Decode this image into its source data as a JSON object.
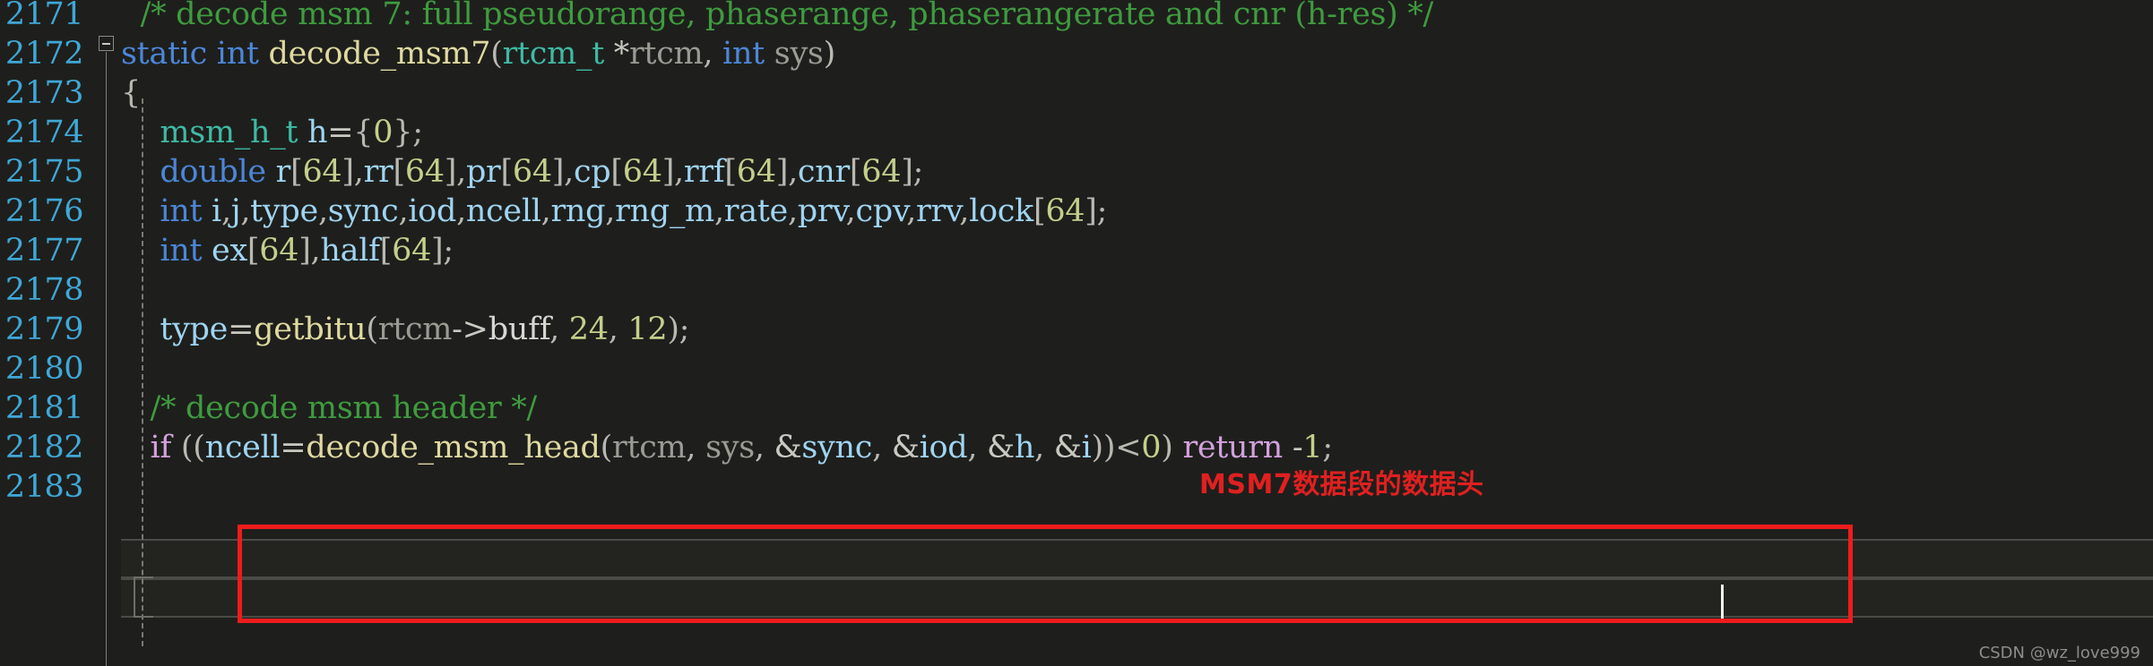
{
  "editor": {
    "background": "#1e1f1c",
    "line_number_color": "#3fa8d8",
    "font_size_px": 35,
    "line_height_px": 44,
    "first_visible_line": 2171,
    "last_visible_line": 2183
  },
  "line_numbers": [
    "2171",
    "2172",
    "2173",
    "2174",
    "2175",
    "2176",
    "2177",
    "2178",
    "2179",
    "2180",
    "2181",
    "2182",
    "2183"
  ],
  "lines": [
    {
      "number": "2171",
      "tokens": [
        {
          "text": "  ",
          "kind": "plain"
        },
        {
          "text": "/* decode msm 7: full pseudorange, phaserange, phaserangerate and cnr (h-res) */",
          "kind": "comment"
        }
      ]
    },
    {
      "number": "2172",
      "tokens": [
        {
          "text": "static",
          "kind": "keyword"
        },
        {
          "text": " ",
          "kind": "plain"
        },
        {
          "text": "int",
          "kind": "keyword"
        },
        {
          "text": " ",
          "kind": "plain"
        },
        {
          "text": "decode_msm7",
          "kind": "func"
        },
        {
          "text": "(",
          "kind": "punct"
        },
        {
          "text": "rtcm_t",
          "kind": "type"
        },
        {
          "text": " ",
          "kind": "plain"
        },
        {
          "text": "*",
          "kind": "op"
        },
        {
          "text": "rtcm",
          "kind": "param"
        },
        {
          "text": ", ",
          "kind": "punct"
        },
        {
          "text": "int",
          "kind": "keyword"
        },
        {
          "text": " ",
          "kind": "plain"
        },
        {
          "text": "sys",
          "kind": "param"
        },
        {
          "text": ")",
          "kind": "punct"
        }
      ]
    },
    {
      "number": "2173",
      "tokens": [
        {
          "text": "{",
          "kind": "punct"
        }
      ]
    },
    {
      "number": "2174",
      "tokens": [
        {
          "text": "    ",
          "kind": "plain"
        },
        {
          "text": "msm_h_t",
          "kind": "type"
        },
        {
          "text": " ",
          "kind": "plain"
        },
        {
          "text": "h",
          "kind": "var"
        },
        {
          "text": "=",
          "kind": "op"
        },
        {
          "text": "{",
          "kind": "punct"
        },
        {
          "text": "0",
          "kind": "num"
        },
        {
          "text": "}",
          "kind": "punct"
        },
        {
          "text": ";",
          "kind": "punct"
        }
      ]
    },
    {
      "number": "2175",
      "tokens": [
        {
          "text": "    ",
          "kind": "plain"
        },
        {
          "text": "double",
          "kind": "keyword"
        },
        {
          "text": " ",
          "kind": "plain"
        },
        {
          "text": "r",
          "kind": "var"
        },
        {
          "text": "[",
          "kind": "punct"
        },
        {
          "text": "64",
          "kind": "num"
        },
        {
          "text": "],",
          "kind": "punct"
        },
        {
          "text": "rr",
          "kind": "var"
        },
        {
          "text": "[",
          "kind": "punct"
        },
        {
          "text": "64",
          "kind": "num"
        },
        {
          "text": "],",
          "kind": "punct"
        },
        {
          "text": "pr",
          "kind": "var"
        },
        {
          "text": "[",
          "kind": "punct"
        },
        {
          "text": "64",
          "kind": "num"
        },
        {
          "text": "],",
          "kind": "punct"
        },
        {
          "text": "cp",
          "kind": "var"
        },
        {
          "text": "[",
          "kind": "punct"
        },
        {
          "text": "64",
          "kind": "num"
        },
        {
          "text": "],",
          "kind": "punct"
        },
        {
          "text": "rrf",
          "kind": "var"
        },
        {
          "text": "[",
          "kind": "punct"
        },
        {
          "text": "64",
          "kind": "num"
        },
        {
          "text": "],",
          "kind": "punct"
        },
        {
          "text": "cnr",
          "kind": "var"
        },
        {
          "text": "[",
          "kind": "punct"
        },
        {
          "text": "64",
          "kind": "num"
        },
        {
          "text": "];",
          "kind": "punct"
        }
      ]
    },
    {
      "number": "2176",
      "tokens": [
        {
          "text": "    ",
          "kind": "plain"
        },
        {
          "text": "int",
          "kind": "keyword"
        },
        {
          "text": " ",
          "kind": "plain"
        },
        {
          "text": "i",
          "kind": "var"
        },
        {
          "text": ",",
          "kind": "punct"
        },
        {
          "text": "j",
          "kind": "var"
        },
        {
          "text": ",",
          "kind": "punct"
        },
        {
          "text": "type",
          "kind": "var"
        },
        {
          "text": ",",
          "kind": "punct"
        },
        {
          "text": "sync",
          "kind": "var"
        },
        {
          "text": ",",
          "kind": "punct"
        },
        {
          "text": "iod",
          "kind": "var"
        },
        {
          "text": ",",
          "kind": "punct"
        },
        {
          "text": "ncell",
          "kind": "var"
        },
        {
          "text": ",",
          "kind": "punct"
        },
        {
          "text": "rng",
          "kind": "var"
        },
        {
          "text": ",",
          "kind": "punct"
        },
        {
          "text": "rng_m",
          "kind": "var"
        },
        {
          "text": ",",
          "kind": "punct"
        },
        {
          "text": "rate",
          "kind": "var"
        },
        {
          "text": ",",
          "kind": "punct"
        },
        {
          "text": "prv",
          "kind": "var"
        },
        {
          "text": ",",
          "kind": "punct"
        },
        {
          "text": "cpv",
          "kind": "var"
        },
        {
          "text": ",",
          "kind": "punct"
        },
        {
          "text": "rrv",
          "kind": "var"
        },
        {
          "text": ",",
          "kind": "punct"
        },
        {
          "text": "lock",
          "kind": "var"
        },
        {
          "text": "[",
          "kind": "punct"
        },
        {
          "text": "64",
          "kind": "num"
        },
        {
          "text": "];",
          "kind": "punct"
        }
      ]
    },
    {
      "number": "2177",
      "tokens": [
        {
          "text": "    ",
          "kind": "plain"
        },
        {
          "text": "int",
          "kind": "keyword"
        },
        {
          "text": " ",
          "kind": "plain"
        },
        {
          "text": "ex",
          "kind": "var"
        },
        {
          "text": "[",
          "kind": "punct"
        },
        {
          "text": "64",
          "kind": "num"
        },
        {
          "text": "],",
          "kind": "punct"
        },
        {
          "text": "half",
          "kind": "var"
        },
        {
          "text": "[",
          "kind": "punct"
        },
        {
          "text": "64",
          "kind": "num"
        },
        {
          "text": "];",
          "kind": "punct"
        }
      ]
    },
    {
      "number": "2178",
      "tokens": []
    },
    {
      "number": "2179",
      "tokens": [
        {
          "text": "    ",
          "kind": "plain"
        },
        {
          "text": "type",
          "kind": "var"
        },
        {
          "text": "=",
          "kind": "op"
        },
        {
          "text": "getbitu",
          "kind": "func"
        },
        {
          "text": "(",
          "kind": "punct"
        },
        {
          "text": "rtcm",
          "kind": "param"
        },
        {
          "text": "->",
          "kind": "op"
        },
        {
          "text": "buff",
          "kind": "plain"
        },
        {
          "text": ", ",
          "kind": "punct"
        },
        {
          "text": "24",
          "kind": "num"
        },
        {
          "text": ", ",
          "kind": "punct"
        },
        {
          "text": "12",
          "kind": "num"
        },
        {
          "text": ");",
          "kind": "punct"
        }
      ]
    },
    {
      "number": "2180",
      "tokens": []
    },
    {
      "number": "2181",
      "tokens": [
        {
          "text": "   ",
          "kind": "plain"
        },
        {
          "text": "/* decode msm header */",
          "kind": "comment"
        }
      ]
    },
    {
      "number": "2182",
      "tokens": [
        {
          "text": "   ",
          "kind": "plain"
        },
        {
          "text": "if",
          "kind": "keyword2"
        },
        {
          "text": " ((",
          "kind": "punct"
        },
        {
          "text": "ncell",
          "kind": "var"
        },
        {
          "text": "=",
          "kind": "op"
        },
        {
          "text": "decode_msm_head",
          "kind": "func"
        },
        {
          "text": "(",
          "kind": "punct"
        },
        {
          "text": "rtcm",
          "kind": "param"
        },
        {
          "text": ", ",
          "kind": "punct"
        },
        {
          "text": "sys",
          "kind": "param"
        },
        {
          "text": ", ",
          "kind": "punct"
        },
        {
          "text": "&",
          "kind": "op"
        },
        {
          "text": "sync",
          "kind": "var"
        },
        {
          "text": ", ",
          "kind": "punct"
        },
        {
          "text": "&",
          "kind": "op"
        },
        {
          "text": "iod",
          "kind": "var"
        },
        {
          "text": ", ",
          "kind": "punct"
        },
        {
          "text": "&",
          "kind": "op"
        },
        {
          "text": "h",
          "kind": "var"
        },
        {
          "text": ", ",
          "kind": "punct"
        },
        {
          "text": "&",
          "kind": "op"
        },
        {
          "text": "i",
          "kind": "var"
        },
        {
          "text": "))<",
          "kind": "punct"
        },
        {
          "text": "0",
          "kind": "num"
        },
        {
          "text": ")",
          "kind": "punct"
        },
        {
          "text": " ",
          "kind": "plain"
        },
        {
          "text": "return",
          "kind": "keyword2"
        },
        {
          "text": " ",
          "kind": "plain"
        },
        {
          "text": "-",
          "kind": "op"
        },
        {
          "text": "1",
          "kind": "num"
        },
        {
          "text": ";",
          "kind": "punct"
        }
      ]
    },
    {
      "number": "2183",
      "tokens": []
    }
  ],
  "annotations": {
    "callout_text": "MSM7数据段的数据头",
    "callout_color": "#e02020",
    "box_color": "#ee1c1c",
    "box_covers_lines": "2181-2182"
  },
  "fold": {
    "marker_line": "2172",
    "marker_glyph": "minus-box"
  },
  "watermark": {
    "text": "CSDN @wz_love999"
  }
}
